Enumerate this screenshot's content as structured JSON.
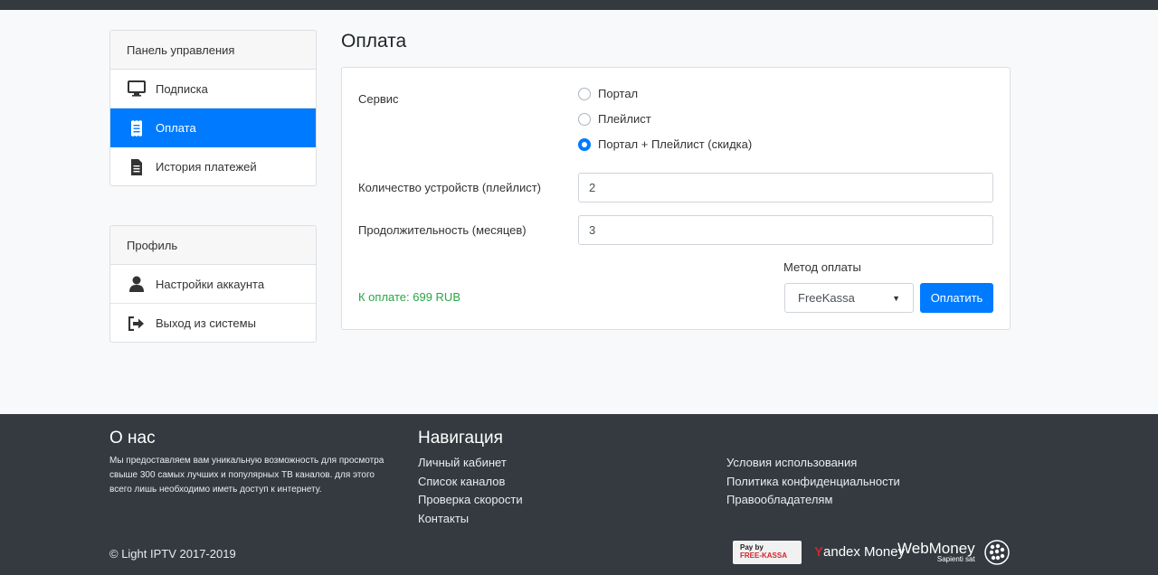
{
  "sidebar": {
    "panel": {
      "title": "Панель управления",
      "items": [
        {
          "label": "Подписка",
          "icon": "monitor-icon"
        },
        {
          "label": "Оплата",
          "icon": "receipt-icon",
          "active": true
        },
        {
          "label": "История платежей",
          "icon": "document-icon"
        }
      ]
    },
    "profile": {
      "title": "Профиль",
      "items": [
        {
          "label": "Настройки аккаунта",
          "icon": "user-icon"
        },
        {
          "label": "Выход из системы",
          "icon": "sign-out-icon"
        }
      ]
    }
  },
  "main": {
    "title": "Оплата",
    "service_label": "Сервис",
    "service_options": [
      {
        "label": "Портал",
        "checked": false
      },
      {
        "label": "Плейлист",
        "checked": false
      },
      {
        "label": "Портал + Плейлист (скидка)",
        "checked": true
      }
    ],
    "devices_label": "Количество устройств (плейлист)",
    "devices_value": "2",
    "duration_label": "Продолжительность (месяцев)",
    "duration_value": "3",
    "method_label": "Метод оплаты",
    "method_value": "FreeKassa",
    "total_text": "К оплате: 699 RUB",
    "pay_button": "Оплатить"
  },
  "footer": {
    "about_title": "О нас",
    "about_text": "Мы предоставляем вам уникальную возможность для просмотра свыше 300 самых лучших и популярных ТВ каналов. для этого всего лишь необходимо иметь доступ к интернету.",
    "nav_title": "Навигация",
    "nav_links": [
      "Личный кабинет",
      "Список каналов",
      "Проверка скорости",
      "Контакты"
    ],
    "legal_links": [
      "Условия использования",
      "Политика конфиденциальности",
      "Правообладателям"
    ],
    "copyright": "© Light IPTV 2017-2019",
    "logos": {
      "freekassa_line1": "Pay by",
      "freekassa_line2": "FREE-KASSA",
      "yandex_y": "Y",
      "yandex_rest": "andex Money",
      "webmoney": "WebMoney",
      "webmoney_sub": "Sapienti sat"
    }
  },
  "colors": {
    "accent": "#007bff",
    "footer_bg": "#343a40",
    "total_green": "#28a745"
  }
}
